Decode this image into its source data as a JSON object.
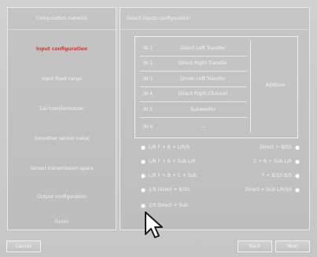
{
  "left_panel": {
    "header": "Computation network",
    "steps": [
      {
        "label": "Input configuration",
        "active": true
      },
      {
        "label": "Input fixed range",
        "active": false
      },
      {
        "label": "Cal transformation",
        "active": false
      },
      {
        "label": "Smoother sensor value",
        "active": false
      },
      {
        "label": "Sensor transmission space",
        "active": false
      },
      {
        "label": "Output configuration",
        "active": false
      },
      {
        "label": "Finish",
        "active": false
      }
    ]
  },
  "right_panel": {
    "header": "Select inputs configuration",
    "ports": [
      {
        "id": "IN 1",
        "name": "Direct Left Transfer"
      },
      {
        "id": "IN 2",
        "name": "Direct Right Transfer"
      },
      {
        "id": "IN 3",
        "name": "Driver Left Transfer"
      },
      {
        "id": "IN 4",
        "name": "Direct Right Channel"
      },
      {
        "id": "IN 5",
        "name": "Subwoofer"
      },
      {
        "id": "IN 6",
        "name": "---"
      }
    ],
    "ports_side_label": "Additive",
    "options_left": [
      "L/R F + B + L/R/S",
      "L/R F + B + Sub L/R",
      "L/R F + B + C + Sub",
      "2/S Direct + B/S5",
      "2/S Direct + Sub"
    ],
    "options_right": [
      "Direct + B/S5",
      "C + B + Sub L/R",
      "F + B/S5 B/S",
      "Direct + Sub L/R/S5"
    ]
  },
  "buttons": {
    "cancel": "Cancel",
    "back": "Back",
    "next": "Next"
  },
  "colors": {
    "active_step": "#e8312a",
    "background": "#c9c9c9",
    "text": "#f4f4f4"
  }
}
